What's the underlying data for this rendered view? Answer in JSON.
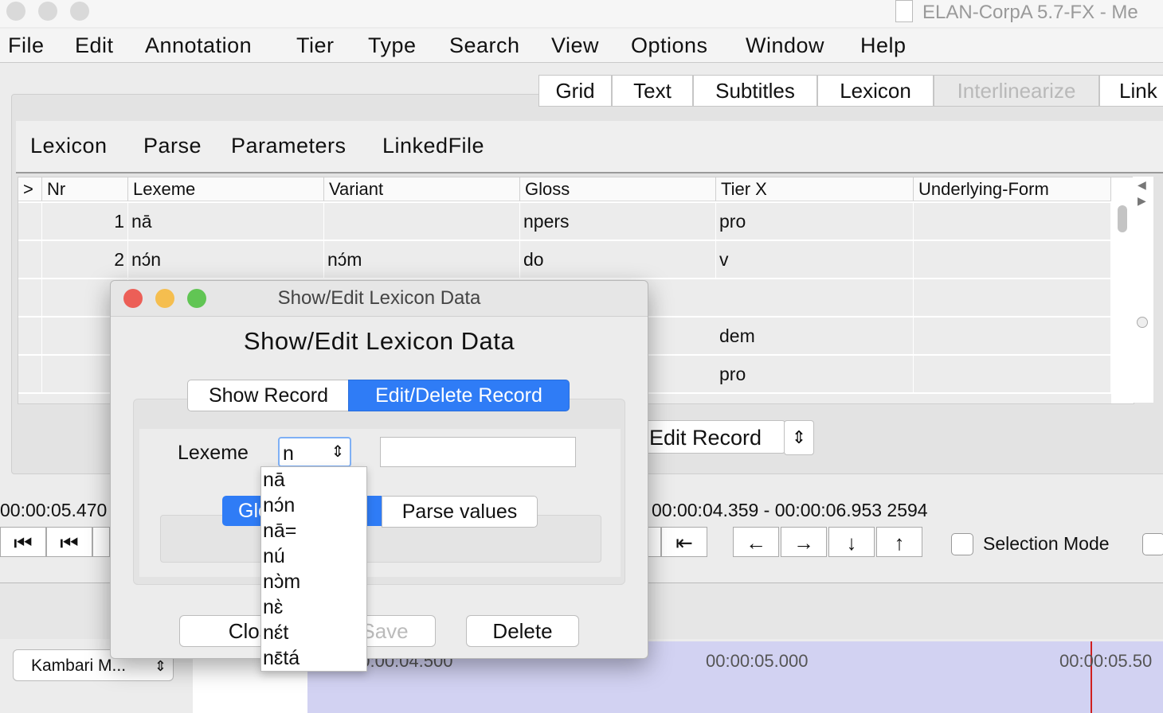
{
  "window": {
    "title": "ELAN-CorpA 5.7-FX - Me"
  },
  "menubar": [
    "File",
    "Edit",
    "Annotation",
    "Tier",
    "Type",
    "Search",
    "View",
    "Options",
    "Window",
    "Help"
  ],
  "top_tabs": [
    {
      "label": "Grid",
      "enabled": true
    },
    {
      "label": "Text",
      "enabled": true
    },
    {
      "label": "Subtitles",
      "enabled": true
    },
    {
      "label": "Lexicon",
      "enabled": true
    },
    {
      "label": "Interlinearize",
      "enabled": false
    },
    {
      "label": "Link",
      "enabled": true
    }
  ],
  "lexicon_tabs": [
    "Lexicon",
    "Parse",
    "Parameters",
    "LinkedFile"
  ],
  "table": {
    "headers": [
      ">",
      "Nr",
      "Lexeme",
      "Variant",
      "Gloss",
      "Tier X",
      "Underlying-Form"
    ],
    "rows": [
      {
        "nr": "1",
        "lexeme": "nā",
        "variant": "",
        "gloss": "npers",
        "tierx": "pro",
        "uform": ""
      },
      {
        "nr": "2",
        "lexeme": "nɔ́n",
        "variant": "nɔ́m",
        "gloss": "do",
        "tierx": "v",
        "uform": ""
      },
      {
        "nr": "",
        "lexeme": "",
        "variant": "",
        "gloss": "",
        "tierx": "",
        "uform": ""
      },
      {
        "nr": "",
        "lexeme": "",
        "variant": "",
        "gloss": "",
        "tierx": "dem",
        "uform": ""
      },
      {
        "nr": "",
        "lexeme": "",
        "variant": "",
        "gloss": "",
        "tierx": "pro",
        "uform": ""
      }
    ]
  },
  "edit_record_select": "Edit Record",
  "timecodes": {
    "left": "00:00:05.470",
    "selection": "00:00:04.359 - 00:00:06.953  2594"
  },
  "selection_mode_label": "Selection Mode",
  "timeline": {
    "tier_select": "Kambari M...",
    "ticks": [
      "00:00:04.500",
      "00:00:05.000",
      "00:00:05.50"
    ]
  },
  "dialog": {
    "title": "Show/Edit Lexicon Data",
    "heading": "Show/Edit Lexicon Data",
    "segments": [
      "Show Record",
      "Edit/Delete Record"
    ],
    "active_segment": "Edit/Delete Record",
    "lexeme_label": "Lexeme",
    "lexeme_value": "n",
    "value_tabs": [
      "Gloss values",
      "Parse values"
    ],
    "buttons": {
      "close": "Close",
      "save": "Save",
      "delete": "Delete"
    },
    "dropdown_options": [
      "nā",
      "nɔ́n",
      "nā=",
      "nú",
      "nɔ̀m",
      "nɛ̀",
      "nɛ́t",
      "nɛ̄tá"
    ]
  },
  "colors": {
    "accent": "#2f7cf6",
    "close_dot": "#ec5f57",
    "min_dot": "#f5be4f",
    "max_dot": "#61c554",
    "cursor": "#d02020",
    "selection": "#d2d2f2"
  }
}
